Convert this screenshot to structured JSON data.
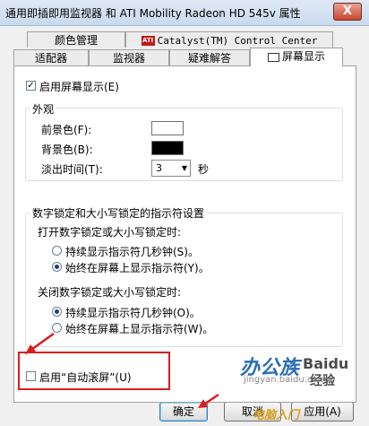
{
  "window": {
    "title": "通用即插即用监视器 和 ATI Mobility Radeon HD 545v 属性",
    "close_label": "X"
  },
  "tabs": {
    "row1": [
      {
        "label": "颜色管理"
      },
      {
        "label": "Catalyst(TM) Control Center",
        "logo_text": "ATI"
      }
    ],
    "row2": [
      {
        "label": "适配器"
      },
      {
        "label": "监视器"
      },
      {
        "label": "疑难解答"
      },
      {
        "label": "屏幕显示",
        "active": true
      }
    ]
  },
  "osd": {
    "enable_label": "启用屏幕显示(E)",
    "enable_checked": true,
    "appearance": {
      "title": "外观",
      "foreground_label": "前景色(F):",
      "foreground_color": "#ffffff",
      "background_label": "背景色(B):",
      "background_color": "#000000",
      "fade_label": "淡出时间(T):",
      "fade_value": "3",
      "fade_unit": "秒"
    },
    "lock_group": {
      "title": "数字锁定和大小写锁定的指示符设置",
      "on_label": "打开数字锁定或大小写锁定时:",
      "on_options": [
        {
          "label": "持续显示指示符几秒钟(S)。",
          "selected": false
        },
        {
          "label": "始终在屏幕上显示指示符(Y)。",
          "selected": true
        }
      ],
      "off_label": "关闭数字锁定或大小写锁定时:",
      "off_options": [
        {
          "label": "持续显示指示符几秒钟(O)。",
          "selected": true
        },
        {
          "label": "始终在屏幕上显示指示符(W)。",
          "selected": false
        }
      ]
    },
    "autoscroll_label": "启用“自动滚屏”(U)",
    "autoscroll_checked": false
  },
  "buttons": {
    "ok": "确定",
    "cancel": "取消",
    "apply": "应用(A)"
  },
  "watermark": {
    "brand_left": "办公族",
    "brand_right": "经验",
    "baidu": "Baidu",
    "url": "jingyan.baidu.com",
    "caption": "电脑入门"
  },
  "colors": {
    "accent_red": "#d81e1e",
    "radio_dot": "#1d3f7a",
    "watermark_blue": "#2e6fb3"
  }
}
